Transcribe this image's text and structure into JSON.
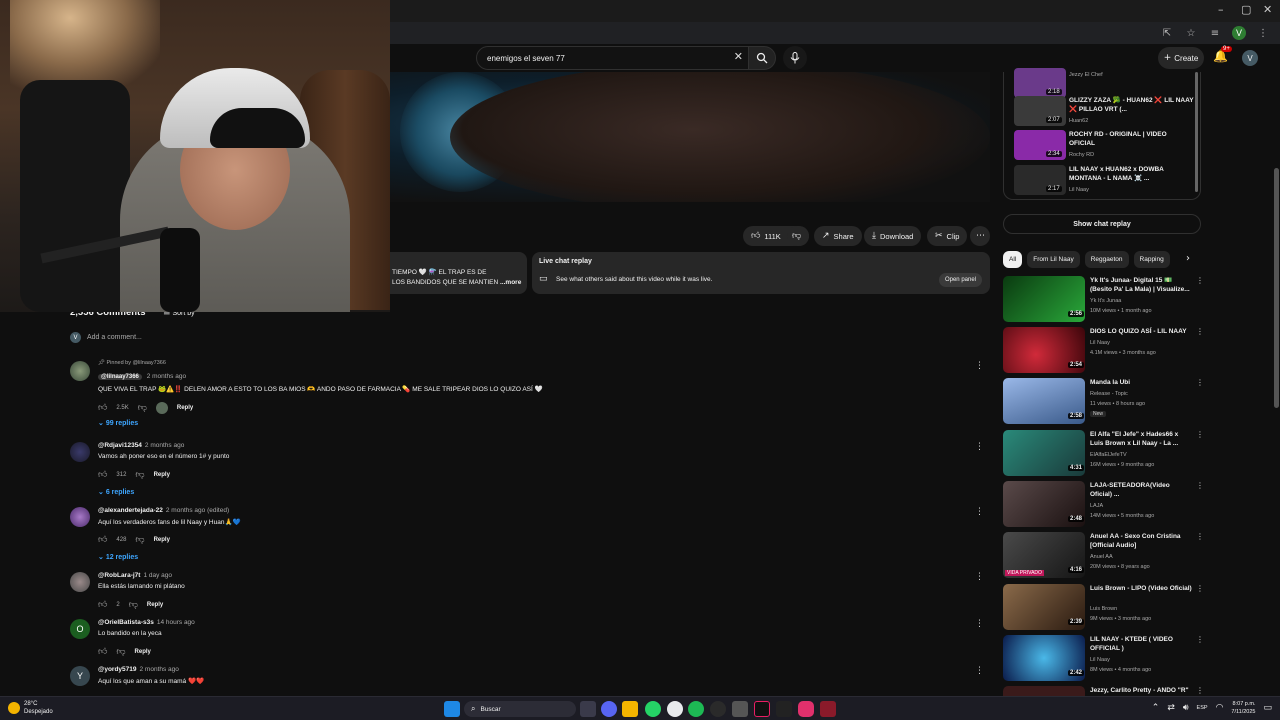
{
  "browser": {
    "window_controls": [
      "–",
      "▢",
      "✕"
    ],
    "profile_initial": "V"
  },
  "header": {
    "search_value": "enemigos el seven 77",
    "create_label": "Create",
    "notif_badge": "9+",
    "avatar_initial": "V"
  },
  "actions": {
    "like_count": "111K",
    "share_label": "Share",
    "download_label": "Download",
    "clip_label": "Clip"
  },
  "description": {
    "line1": "TIEMPO 🤍 ⚗️ EL TRAP ES DE",
    "line2": "LOS BANDIDOS QUE SE MANTIEN",
    "more": "...more"
  },
  "chat_replay": {
    "title": "Live chat replay",
    "subtitle": "See what others said about this video while it was live.",
    "open_label": "Open panel"
  },
  "comments": {
    "count_label": "2,556 Comments",
    "sort_label": "Sort by",
    "add_placeholder": "Add a comment...",
    "self_initial": "V",
    "items": [
      {
        "pinned": "Pinned by @lilnaay7366",
        "author": "@lilnaay7366",
        "time": "2 months ago",
        "text": "QUE VIVA EL TRAP 🐸⚠️‼️ DELEN AMOR A ESTO TO LOS BA MIOS 🫶 ANDO PASO DE FARMACIA 💊 ME SALE TRIPEAR DIOS LO QUIZO ASÍ 🤍",
        "likes": "2.5K",
        "reply": "Reply",
        "replies": "99 replies"
      },
      {
        "author": "@Rdjavi12354",
        "time": "2 months ago",
        "text": "Vamos ah poner eso en el número 1# y punto",
        "likes": "312",
        "reply": "Reply",
        "replies": "6 replies"
      },
      {
        "author": "@alexandertejada-22",
        "time": "2 months ago (edited)",
        "text": "Aquí los verdaderos fans de lil Naay y Huan🙏💙",
        "likes": "428",
        "reply": "Reply",
        "replies": "12 replies"
      },
      {
        "author": "@RobLara-j7t",
        "time": "1 day ago",
        "text": "Ella estás lamando mi plátano",
        "likes": "2",
        "reply": "Reply"
      },
      {
        "author": "@OrielBatista-s3s",
        "time": "14 hours ago",
        "text": "Lo bandido en la yeca",
        "initial": "O",
        "reply": "Reply"
      },
      {
        "author": "@yordy5719",
        "time": "2 months ago",
        "text": "Aquí los que aman a su mamá ❤️❤️",
        "initial": "Y"
      }
    ]
  },
  "chat_list": [
    {
      "title": "",
      "channel": "Jezzy El Chef",
      "dur": "2:18",
      "color": "#6a3a8a"
    },
    {
      "title": "GLIZZY ZAZA 🥦 - HUAN62 ❌ LIL NAAY ❌ PILLAO VRT (...",
      "channel": "Huan62",
      "dur": "2:07",
      "color": "#3a3a3a"
    },
    {
      "title": "ROCHY RD - ORIGINAL | VIDEO OFICIAL",
      "channel": "Rochy RD",
      "dur": "2:34",
      "color": "#8a2aa8"
    },
    {
      "title": "LIL NAAY x HUAN62 x DOWBA MONTANA - L NAMA ☠️ ...",
      "channel": "Lil Naay",
      "dur": "2:17",
      "color": "#2a2a2a"
    }
  ],
  "show_chat_label": "Show chat replay",
  "filters": [
    "All",
    "From Lil Naay",
    "Reggaeton",
    "Rapping"
  ],
  "recommendations": [
    {
      "title": "Yk It's Junaa- Digital 15 💵 (Besito Pa' La Mala) | Visualize...",
      "channel": "Yk It's Junaa",
      "meta": "10M views • 1 month ago",
      "dur": "2:56",
      "color": "#1f7a2a"
    },
    {
      "title": "DIOS LO QUIZO ASÍ - LIL NAAY",
      "channel": "Lil Naay",
      "meta": "4.1M views • 3 months ago",
      "dur": "2:54",
      "color": "#7a0f1a"
    },
    {
      "title": "Manda la Ubi",
      "channel": "Release - Topic",
      "meta": "11 views • 8 hours ago",
      "dur": "2:58",
      "color": "#5a7aa8",
      "badge": "New"
    },
    {
      "title": "El Alfa \"El Jefe\" x Hades66 x Luis Brown x Lil Naay - La ...",
      "channel": "ElAlfaElJefeTV",
      "meta": "16M views • 9 months ago",
      "dur": "4:31",
      "color": "#2a6a5a"
    },
    {
      "title": "LAJA-SETEADORA(Video Oficial) ...",
      "channel": "LAJA",
      "meta": "14M views • 5 months ago",
      "dur": "2:48",
      "color": "#3a2a2a"
    },
    {
      "title": "Anuel AA - Sexo Con Cristina [Official Audio]",
      "channel": "Anuel AA",
      "meta": "20M views • 8 years ago",
      "dur": "4:16",
      "color": "#2a2a2a",
      "overlay": "VIDA PRIVADO"
    },
    {
      "title": "Luis Brown - LIPO (Video Oficial)",
      "channel": "Luis Brown",
      "meta": "9M views • 3 months ago",
      "dur": "2:39",
      "color": "#5a4a3a"
    },
    {
      "title": "LIL NAAY - KTEDE ( VIDEO OFFICIAL )",
      "channel": "Lil Naay",
      "meta": "8M views • 4 months ago",
      "dur": "2:42",
      "color": "#1a4a8a"
    },
    {
      "title": "Jezzy, Carlito Pretty - ANDO \"R\"",
      "channel": "",
      "meta": "",
      "dur": "",
      "color": "#3a1a1a"
    }
  ],
  "taskbar": {
    "temp": "28°C",
    "weather": "Despejado",
    "search": "Buscar",
    "lang": "ESP",
    "time": "8:07 p.m.",
    "date": "7/11/2025"
  }
}
